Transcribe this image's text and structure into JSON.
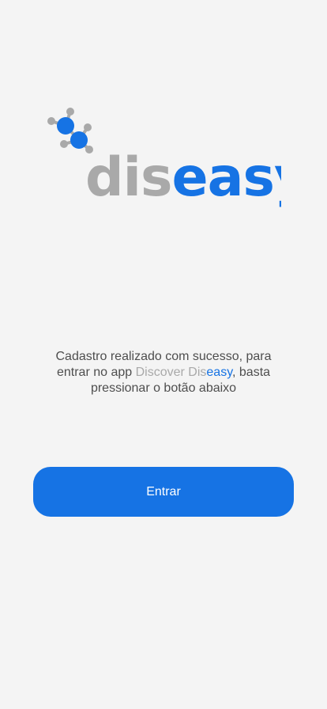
{
  "brand": {
    "wordmark_part1": "dis",
    "wordmark_part2": "easy",
    "logo_icon": "molecule-icon",
    "colors": {
      "gray": "#a9a9a9",
      "blue": "#1673e4"
    }
  },
  "message": {
    "line1": "Cadastro realizado com sucesso, para",
    "prefix": "entrar no app ",
    "app_name_part1": "Discover Dis",
    "app_name_part2": "easy",
    "suffix": ", basta",
    "line3": "pressionar o botão abaixo"
  },
  "actions": {
    "enter_label": "Entrar"
  }
}
